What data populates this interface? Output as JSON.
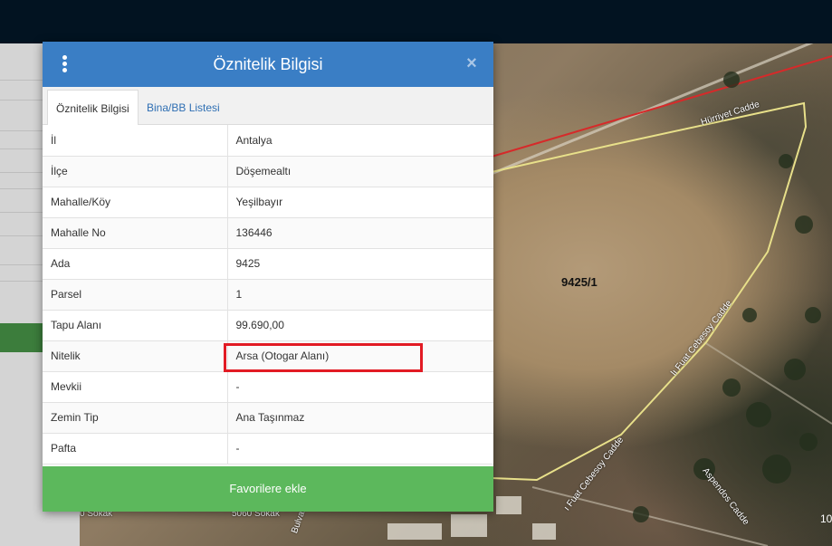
{
  "dialog": {
    "title": "Öznitelik Bilgisi",
    "close_icon": "close-icon",
    "menu_icon": "kebab-menu-icon",
    "tabs": [
      {
        "label": "Öznitelik Bilgisi",
        "active": true
      },
      {
        "label": "Bina/BB Listesi",
        "active": false
      }
    ],
    "attributes": [
      {
        "key": "İl",
        "value": "Antalya"
      },
      {
        "key": "İlçe",
        "value": "Döşemealtı"
      },
      {
        "key": "Mahalle/Köy",
        "value": "Yeşilbayır"
      },
      {
        "key": "Mahalle No",
        "value": "136446"
      },
      {
        "key": "Ada",
        "value": "9425"
      },
      {
        "key": "Parsel",
        "value": "1"
      },
      {
        "key": "Tapu Alanı",
        "value": "99.690,00"
      },
      {
        "key": "Nitelik",
        "value": "Arsa (Otogar Alanı)"
      },
      {
        "key": "Mevkii",
        "value": "-"
      },
      {
        "key": "Zemin Tip",
        "value": "Ana Taşınmaz"
      },
      {
        "key": "Pafta",
        "value": "-"
      }
    ],
    "favorite_button": "Favorilere ekle"
  },
  "map": {
    "parcel_label": "9425/1",
    "roads": {
      "hurriyet": "Hürriyet Cadde",
      "cebesoy_1": "lı Fuat Cebesoy Cadde",
      "cebesoy_2": "ı Fuat Cebesoy Cadde",
      "aspendos": "Aspendos Cadde",
      "sokak_1": "5060 Sokak",
      "sokak_2": "0 Sokak",
      "bulvar": "Bulvar"
    },
    "corner_text": "10",
    "colors": {
      "parcel_outline": "#e8e08a",
      "red_line": "#d62a2a"
    }
  },
  "colors": {
    "header": "#3a7ec5",
    "favorite_button": "#5cb85c",
    "highlight": "#e21b24",
    "topbar": "#021321"
  }
}
